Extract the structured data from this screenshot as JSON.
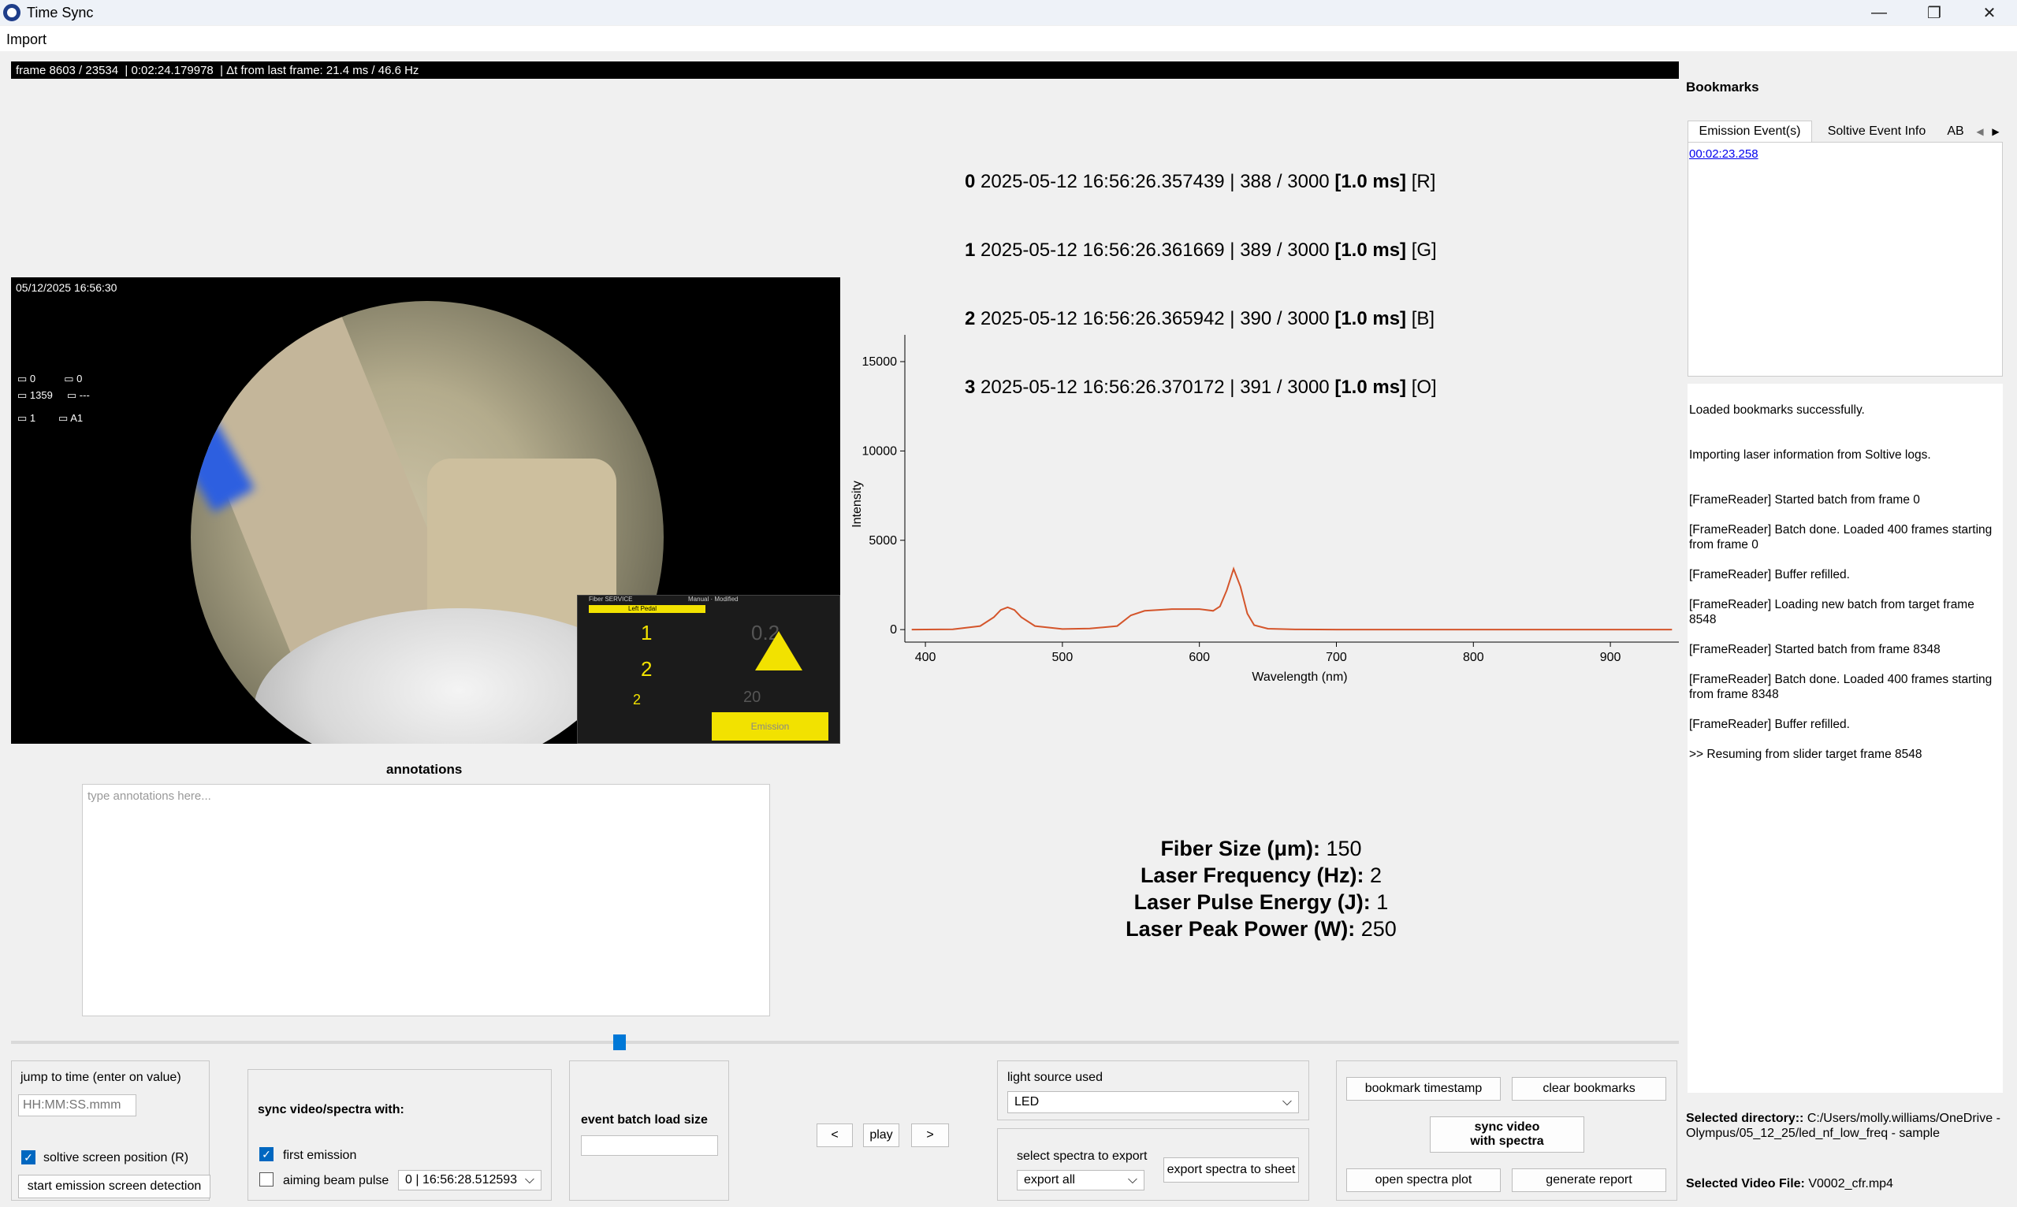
{
  "window": {
    "title": "Time Sync",
    "minimize": "—",
    "restore": "❐",
    "close": "✕"
  },
  "menu": {
    "import": "Import"
  },
  "frame_bar": "frame 8603 / 23534  | 0:02:24.179978  | Δt from last frame: 21.4 ms / 46.6 Hz",
  "camera_timestamps": [
    {
      "idx": "0",
      "time": "2025-05-12 16:56:26.357439 | 388 / 3000",
      "dur": "[1.0 ms]",
      "ch": "[R]"
    },
    {
      "idx": "1",
      "time": "2025-05-12 16:56:26.361669 | 389 / 3000",
      "dur": "[1.0 ms]",
      "ch": "[G]"
    },
    {
      "idx": "2",
      "time": "2025-05-12 16:56:26.365942 | 390 / 3000",
      "dur": "[1.0 ms]",
      "ch": "[B]"
    },
    {
      "idx": "3",
      "time": "2025-05-12 16:56:26.370172 | 391 / 3000",
      "dur": "[1.0 ms]",
      "ch": "[O]"
    }
  ],
  "video": {
    "overlay_date": "05/12/2025   16:56:30",
    "overlay_info": [
      "0",
      "0",
      "1359",
      "---",
      "1",
      "A1"
    ],
    "laser_panel": {
      "header": "Fiber SERVICE",
      "mode": "Manual · Modified",
      "pedal": "Left Pedal",
      "energy": "1",
      "frequency": "2",
      "power": "2",
      "right_value": "0.2",
      "right_power": "20",
      "emission": "Emission"
    }
  },
  "annotations": {
    "label": "annotations",
    "placeholder": "type annotations here..."
  },
  "chart_data": {
    "type": "line",
    "xlabel": "Wavelength (nm)",
    "ylabel": "Intensity",
    "xlim": [
      385,
      950
    ],
    "ylim": [
      -700,
      16500
    ],
    "xticks": [
      400,
      500,
      600,
      700,
      800,
      900
    ],
    "yticks": [
      0,
      5000,
      10000,
      15000
    ],
    "color": "#d4552b",
    "series": [
      {
        "x": [
          390,
          420,
          440,
          450,
          455,
          460,
          465,
          470,
          480,
          500,
          520,
          540,
          550,
          560,
          580,
          600,
          610,
          615,
          620,
          625,
          630,
          635,
          640,
          650,
          670,
          700,
          800,
          900,
          945
        ],
        "values": [
          0,
          20,
          200,
          700,
          1100,
          1250,
          1100,
          700,
          200,
          30,
          60,
          200,
          800,
          1050,
          1150,
          1150,
          1050,
          1300,
          2200,
          3400,
          2400,
          900,
          250,
          50,
          10,
          0,
          0,
          0,
          0
        ]
      }
    ]
  },
  "laser_info": [
    {
      "label": "Fiber Size (μm):",
      "value": "150"
    },
    {
      "label": "Laser Frequency (Hz):",
      "value": "2"
    },
    {
      "label": "Laser Pulse Energy (J):",
      "value": "1"
    },
    {
      "label": "Laser Peak Power (W):",
      "value": "250"
    }
  ],
  "slider": {
    "value_fraction": 0.365
  },
  "controls": {
    "jump_label": "jump to time (enter on value)",
    "jump_placeholder": "HH:MM:SS.mmm",
    "soltive_pos_label": "soltive screen position (R)",
    "soltive_pos_checked": true,
    "start_detection": "start emission screen detection",
    "sync_title": "sync video/spectra with:",
    "first_emission": "first emission",
    "first_emission_checked": true,
    "aiming_beam": "aiming beam pulse",
    "aiming_beam_checked": false,
    "aiming_select": "0 | 16:56:28.512593",
    "batch_label": "event batch load size",
    "batch_value": "",
    "prev": "<",
    "play": "play",
    "next": ">",
    "light_source_label": "light source used",
    "light_source_value": "LED",
    "select_spectra_label": "select spectra to export",
    "select_spectra_value": "export all",
    "export_sheet": "export spectra to sheet",
    "bookmark_ts": "bookmark timestamp",
    "clear_bm": "clear bookmarks",
    "sync_video": "sync video\nwith spectra",
    "open_plot": "open spectra plot",
    "gen_report": "generate report"
  },
  "bookmarks": {
    "title": "Bookmarks",
    "tabs": [
      "Emission Event(s)",
      "Soltive Event Info",
      "AB"
    ],
    "items": [
      "00:02:23.258"
    ]
  },
  "log": [
    "Loaded bookmarks successfully.",
    "Importing laser information from Soltive logs.",
    "[FrameReader] Started batch from frame 0",
    "[FrameReader] Batch done. Loaded 400 frames starting from frame 0",
    "[FrameReader] Buffer refilled.",
    "[FrameReader] Loading new batch from target frame 8548",
    "[FrameReader] Started batch from frame 8348",
    "[FrameReader] Batch done. Loaded 400 frames starting from frame 8348",
    "[FrameReader] Buffer refilled.",
    ">> Resuming from slider target frame 8548"
  ],
  "selected": {
    "dir_label": "Selected directory::",
    "dir_value": "C:/Users/molly.williams/OneDrive - Olympus/05_12_25/led_nf_low_freq - sample",
    "video_label": "Selected Video File:",
    "video_value": "V0002_cfr.mp4"
  }
}
